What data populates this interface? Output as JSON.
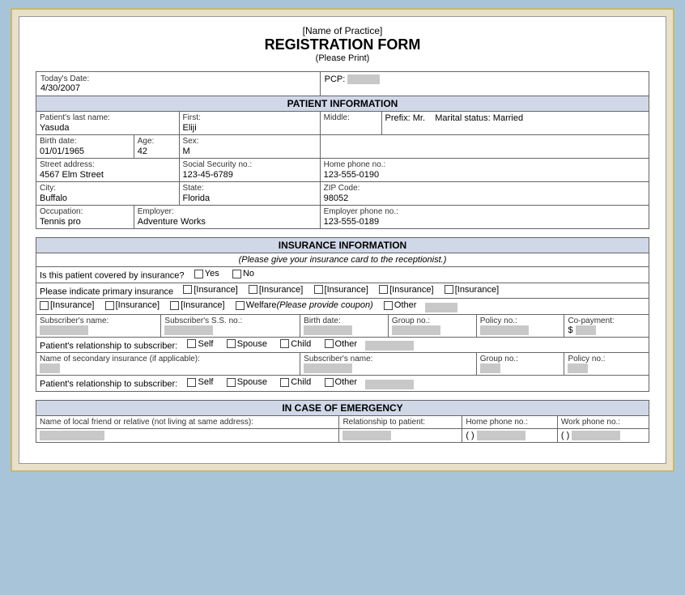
{
  "header": {
    "practice_name": "[Name of Practice]",
    "form_title": "REGISTRATION FORM",
    "print_note": "(Please Print)"
  },
  "top_row": {
    "date_label": "Today's Date:",
    "date_value": "4/30/2007",
    "pcp_label": "PCP:"
  },
  "patient_section": {
    "header": "PATIENT INFORMATION",
    "last_name_label": "Patient's last name:",
    "last_name": "Yasuda",
    "first_label": "First:",
    "first_name": "Eliji",
    "middle_label": "Middle:",
    "prefix_label": "Prefix:",
    "prefix_value": "Mr.",
    "marital_label": "Marital status:",
    "marital_value": "Married",
    "birth_label": "Birth date:",
    "birth_value": "01/01/1965",
    "age_label": "Age:",
    "age_value": "42",
    "sex_label": "Sex:",
    "sex_value": "M",
    "street_label": "Street address:",
    "street_value": "4567 Elm Street",
    "ssn_label": "Social Security no.:",
    "ssn_value": "123-45-6789",
    "home_phone_label": "Home phone no.:",
    "home_phone_value": "123-555-0190",
    "city_label": "City:",
    "city_value": "Buffalo",
    "state_label": "State:",
    "state_value": "Florida",
    "zip_label": "ZIP Code:",
    "zip_value": "98052",
    "occupation_label": "Occupation:",
    "occupation_value": "Tennis pro",
    "employer_label": "Employer:",
    "employer_value": "Adventure Works",
    "employer_phone_label": "Employer phone no.:",
    "employer_phone_value": "123-555-0189"
  },
  "insurance_section": {
    "header": "INSURANCE INFORMATION",
    "note": "(Please give your insurance card to the receptionist.)",
    "covered_label": "Is this patient covered by insurance?",
    "yes_label": "Yes",
    "no_label": "No",
    "primary_label": "Please indicate primary insurance",
    "ins1": "[Insurance]",
    "ins2": "[Insurance]",
    "ins3": "[Insurance]",
    "ins4": "[Insurance]",
    "ins5": "[Insurance]",
    "ins6": "[Insurance]",
    "ins7": "[Insurance]",
    "ins8": "[Insurance]",
    "welfare_label": "Welfare",
    "welfare_note": "(Please provide coupon)",
    "other_label": "Other",
    "sub_name_label": "Subscriber's name:",
    "sub_ss_label": "Subscriber's S.S. no.:",
    "birth_date_label": "Birth date:",
    "group_no_label": "Group no.:",
    "policy_no_label": "Policy no.:",
    "copay_label": "Co-payment:",
    "copay_prefix": "$",
    "relationship_label": "Patient's relationship to subscriber:",
    "self_label": "Self",
    "spouse_label": "Spouse",
    "child_label": "Child",
    "other2_label": "Other",
    "secondary_label": "Name of secondary insurance (if applicable):",
    "sub_name2_label": "Subscriber's name:",
    "group2_label": "Group no.:",
    "policy2_label": "Policy no.:",
    "relationship2_label": "Patient's relationship to subscriber:",
    "self2_label": "Self",
    "spouse2_label": "Spouse",
    "child2_label": "Child",
    "other3_label": "Other"
  },
  "emergency_section": {
    "header": "IN CASE OF EMERGENCY",
    "friend_label": "Name of local friend or relative (not living at same address):",
    "relationship_label": "Relationship to patient:",
    "home_phone_label": "Home phone no.:",
    "home_phone_format": "( )",
    "work_phone_label": "Work phone no.:",
    "work_phone_format": "( )"
  }
}
